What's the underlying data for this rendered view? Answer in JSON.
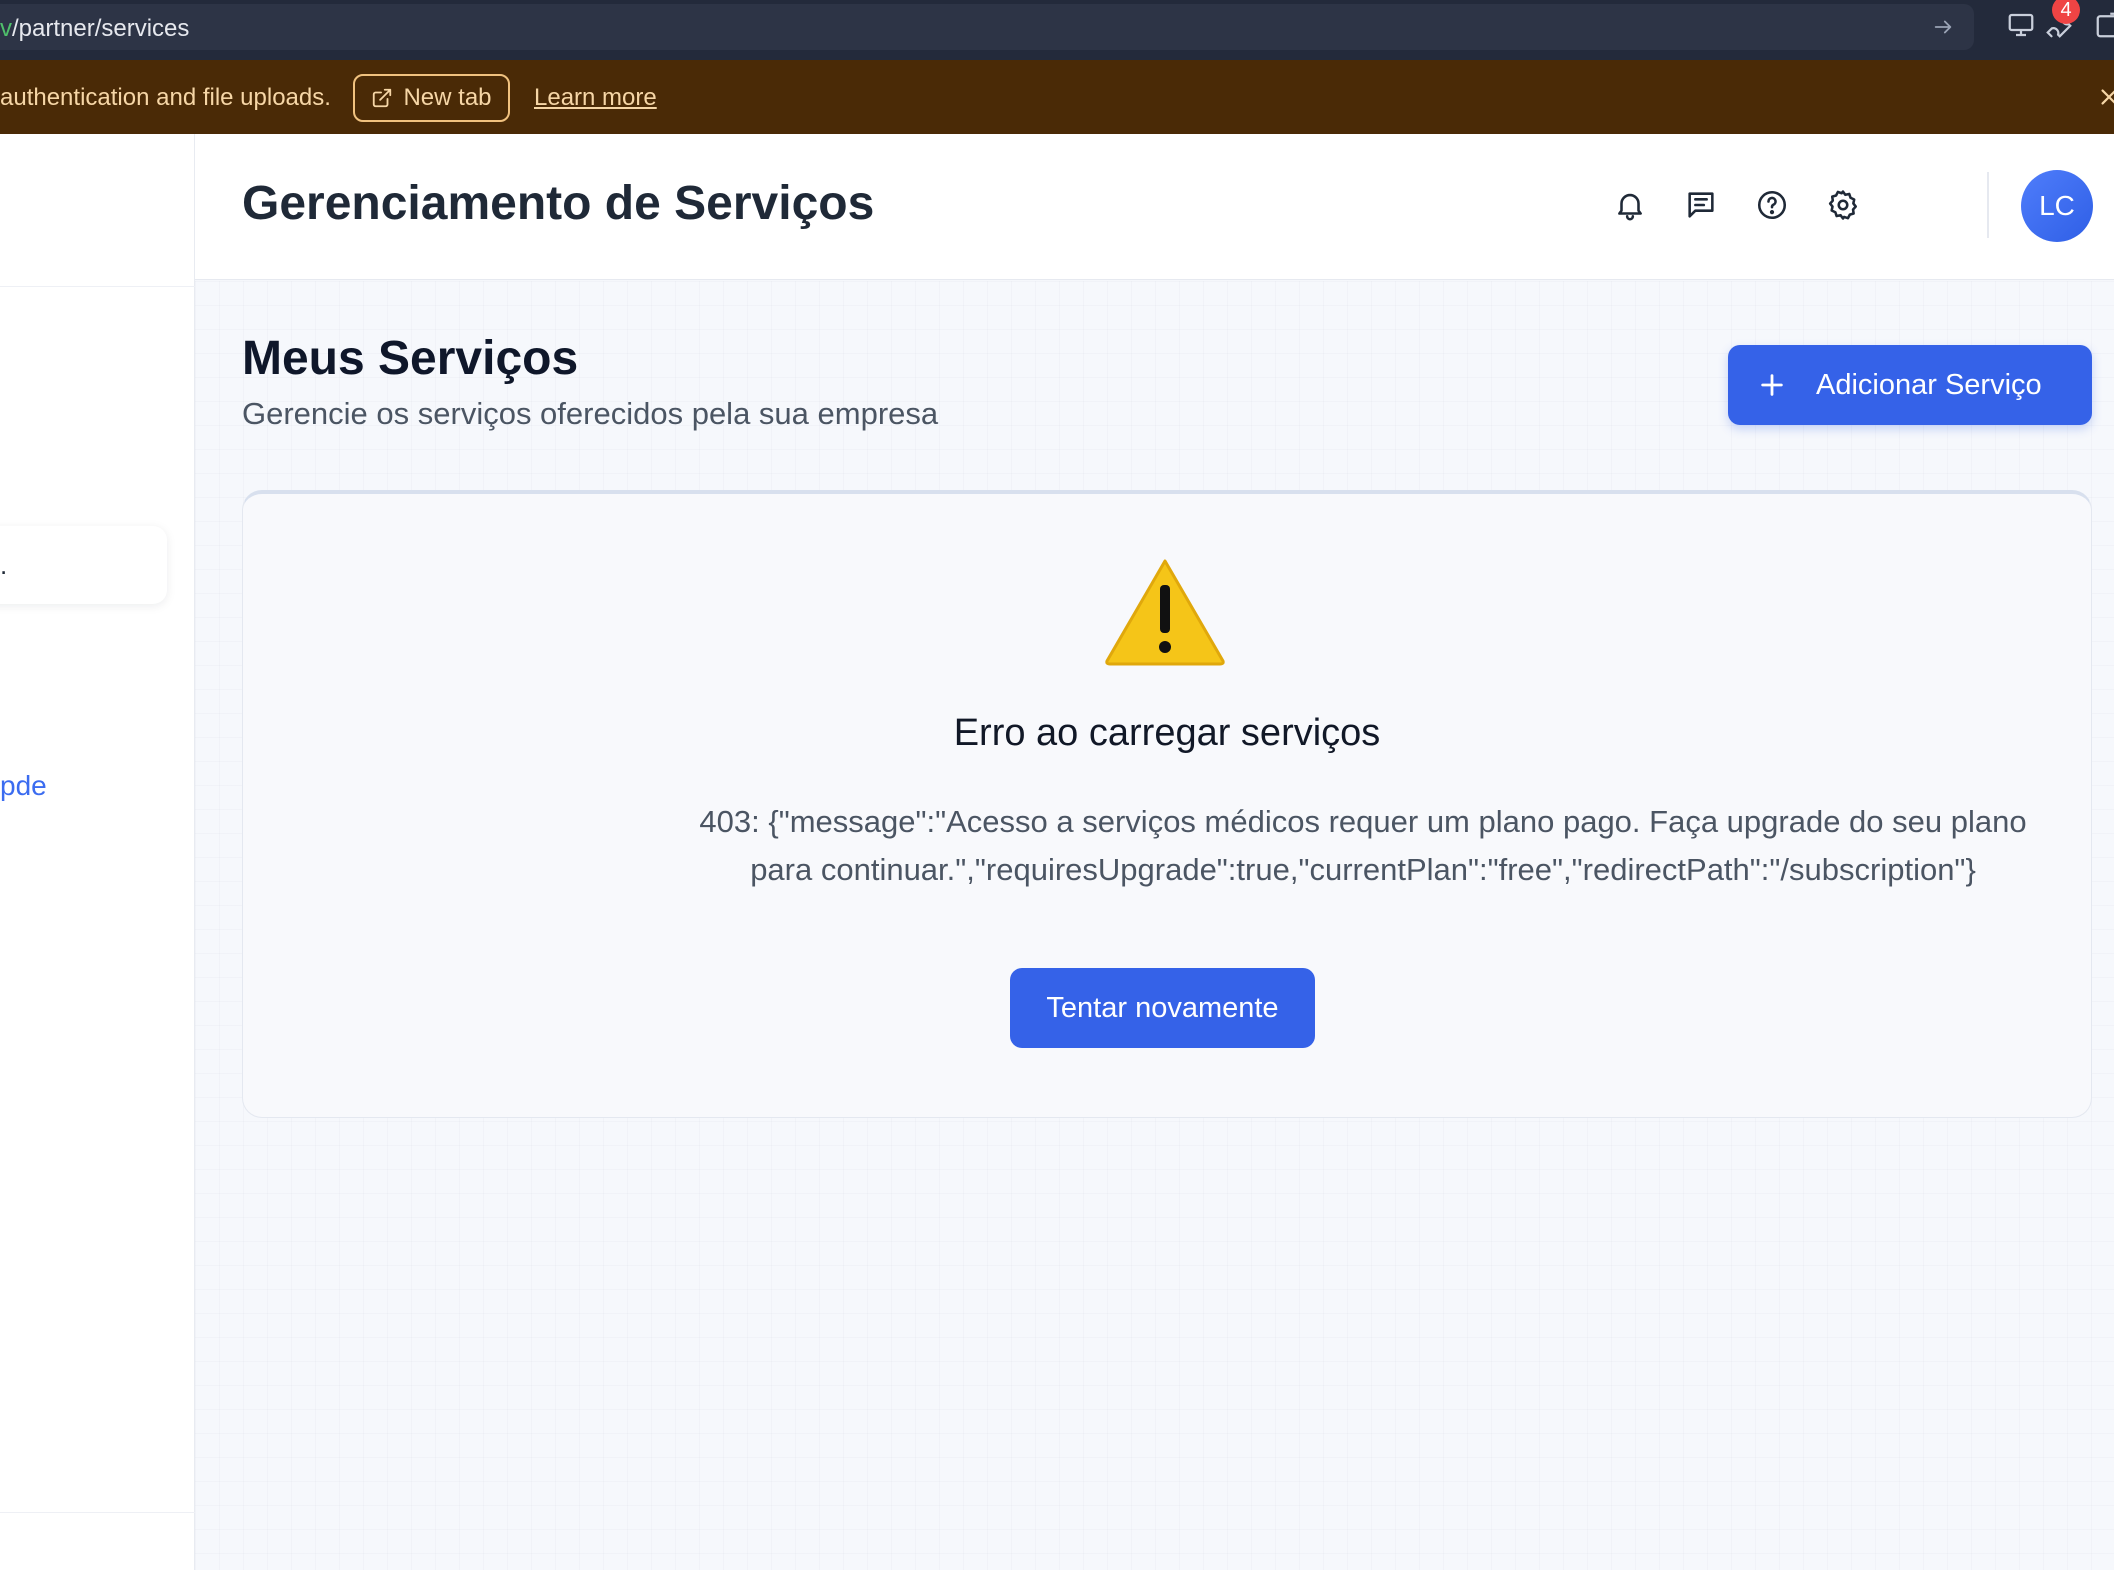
{
  "browser": {
    "url_host": "v",
    "url_path": "/partner/services",
    "extension_badge": "4"
  },
  "banner": {
    "text": "authentication and file uploads.",
    "new_tab_label": "New tab",
    "learn_more_label": "Learn more"
  },
  "sidebar": {
    "link_partial": "pde"
  },
  "header": {
    "title": "Gerenciamento de Serviços",
    "avatar_initials": "LC",
    "icons": [
      "bell-icon",
      "message-icon",
      "help-icon",
      "settings-icon"
    ]
  },
  "page": {
    "title": "Meus Serviços",
    "subtitle": "Gerencie os serviços oferecidos pela sua empresa",
    "add_button_label": "Adicionar Serviço"
  },
  "error": {
    "title": "Erro ao carregar serviços",
    "message": "403: {\"message\":\"Acesso a serviços médicos requer um plano pago. Faça upgrade do seu plano para continuar.\",\"requiresUpgrade\":true,\"currentPlan\":\"free\",\"redirectPath\":\"/subscription\"}",
    "retry_label": "Tentar novamente"
  },
  "colors": {
    "primary": "#3562e8",
    "banner_bg": "#4a2a06",
    "warning": "#f5c518"
  }
}
